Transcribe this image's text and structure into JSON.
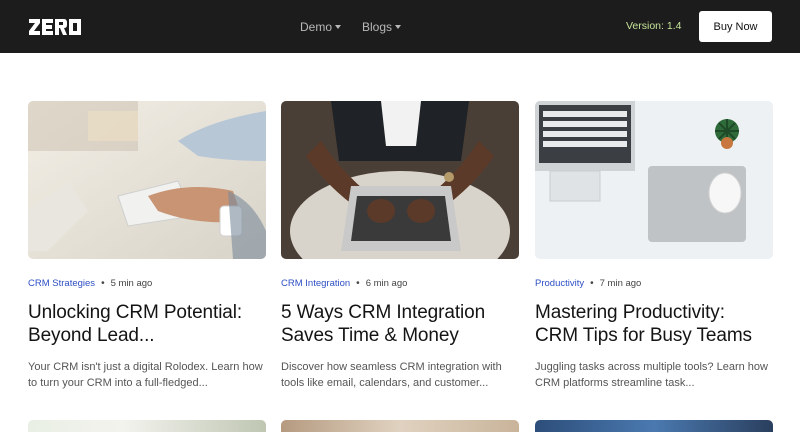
{
  "navbar": {
    "logo_text": "ZERO",
    "menu": [
      {
        "label": "Demo"
      },
      {
        "label": "Blogs"
      }
    ],
    "version": "Version: 1.4",
    "buy_label": "Buy Now"
  },
  "posts": [
    {
      "category": "CRM Strategies",
      "time": "5 min ago",
      "title": "Unlocking CRM Potential: Beyond Lead...",
      "excerpt": "Your CRM isn't just a digital Rolodex. Learn how to turn your CRM into a full-fledged..."
    },
    {
      "category": "CRM Integration",
      "time": "6 min ago",
      "title": "5 Ways CRM Integration Saves Time & Money",
      "excerpt": "Discover how seamless CRM integration with tools like email, calendars, and customer..."
    },
    {
      "category": "Productivity",
      "time": "7 min ago",
      "title": "Mastering Productivity: CRM Tips for Busy Teams",
      "excerpt": "Juggling tasks across multiple tools? Learn how CRM platforms streamline task..."
    }
  ],
  "colors": {
    "navbar_bg": "#1c1c1c",
    "category": "#2d4fc4",
    "version": "#c6e59a"
  }
}
